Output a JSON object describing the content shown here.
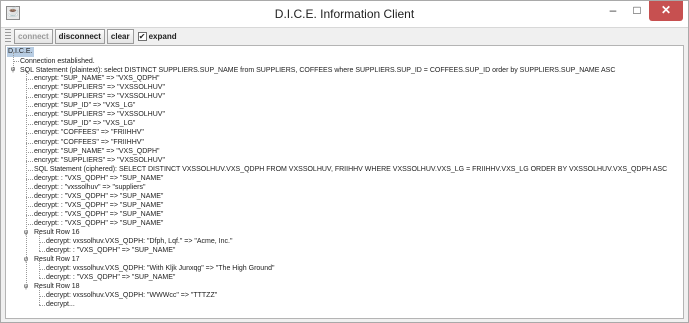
{
  "window": {
    "title": "D.I.C.E. Information Client",
    "minimize": "–",
    "maximize": "□",
    "close": "✕"
  },
  "toolbar": {
    "connect": "connect",
    "disconnect": "disconnect",
    "clear": "clear",
    "expand": "expand",
    "expand_checked": "✔"
  },
  "tree": {
    "root": "D.I.C.E.",
    "connection": "Connection established.",
    "sql_plain": "SQL Statement (plaintext): select DISTINCT SUPPLIERS.SUP_NAME    from SUPPLIERS, COFFEES    where SUPPLIERS.SUP_ID = COFFEES.SUP_ID order by SUPPLIERS.SUP_NAME ASC",
    "sql_children": [
      "encrypt: \"SUP_NAME\" => \"VXS_QDPH\"",
      "encrypt: \"SUPPLIERS\" => \"VXSSOLHUV\"",
      "encrypt: \"SUPPLIERS\" => \"VXSSOLHUV\"",
      "encrypt: \"SUP_ID\" => \"VXS_LG\"",
      "encrypt: \"SUPPLIERS\" => \"VXSSOLHUV\"",
      "encrypt: \"SUP_ID\" => \"VXS_LG\"",
      "encrypt: \"COFFEES\" => \"FRIIHHV\"",
      "encrypt: \"COFFEES\" => \"FRIIHHV\"",
      "encrypt: \"SUP_NAME\" => \"VXS_QDPH\"",
      "encrypt: \"SUPPLIERS\" => \"VXSSOLHUV\"",
      "SQL Statement (ciphered): SELECT DISTINCT VXSSOLHUV.VXS_QDPH FROM VXSSOLHUV, FRIIHHV WHERE VXSSOLHUV.VXS_LG = FRIIHHV.VXS_LG ORDER BY VXSSOLHUV.VXS_QDPH ASC",
      "decrypt: : \"VXS_QDPH\" => \"SUP_NAME\"",
      "decrypt: : \"vxssolhuv\" => \"suppliers\"",
      "decrypt: : \"VXS_QDPH\" => \"SUP_NAME\"",
      "decrypt: : \"VXS_QDPH\" => \"SUP_NAME\"",
      "decrypt: : \"VXS_QDPH\" => \"SUP_NAME\"",
      "decrypt: : \"VXS_QDPH\" => \"SUP_NAME\""
    ],
    "rows": [
      {
        "label": "Result Row 16",
        "children": [
          "decrypt: vxssolhuv.VXS_QDPH: \"Dfph, Lqf.\" => \"Acme, Inc.\"",
          "decrypt: : \"VXS_QDPH\" => \"SUP_NAME\""
        ]
      },
      {
        "label": "Result Row 17",
        "children": [
          "decrypt: vxssolhuv.VXS_QDPH: \"With Kljk Junxqg\" => \"The High Ground\"",
          "decrypt: : \"VXS_QDPH\" => \"SUP_NAME\""
        ]
      },
      {
        "label": "Result Row 18",
        "children": [
          "decrypt: vxssolhuv.VXS_QDPH: \"WWWcc\" => \"TTTZZ\"",
          "decrypt..."
        ]
      }
    ],
    "toggle_symbol": "φ"
  }
}
